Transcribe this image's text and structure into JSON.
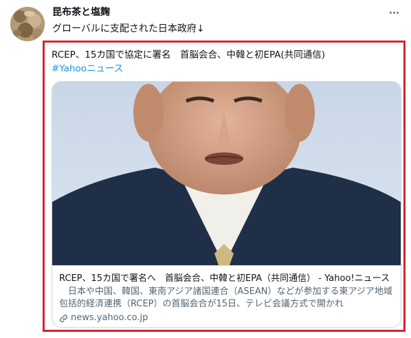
{
  "tweet": {
    "display_name": "昆布茶と塩麹",
    "text": "グローバルに支配された日本政府↓",
    "quoted_text": "RCEP、15カ国で協定に署名　首脳会合、中韓と初EPA(共同通信)",
    "hashtag": "#Yahooニュース"
  },
  "card": {
    "title": "RCEP、15カ国で署名へ　首脳会合、中韓と初EPA（共同通信） - Yahoo!ニュース",
    "description": "日本や中国、韓国、東南アジア諸国連合（ASEAN）などが参加する東アジア地域包括的経済連携（RCEP）の首脳会合が15日、テレビ会議方式で開かれ",
    "domain": "news.yahoo.co.jp"
  },
  "colors": {
    "highlight_border": "#d12434",
    "hashtag": "#1b95e0",
    "muted_text": "#536471",
    "card_border": "#cfd9de"
  },
  "icons": [
    "more-options-icon",
    "link-icon"
  ]
}
